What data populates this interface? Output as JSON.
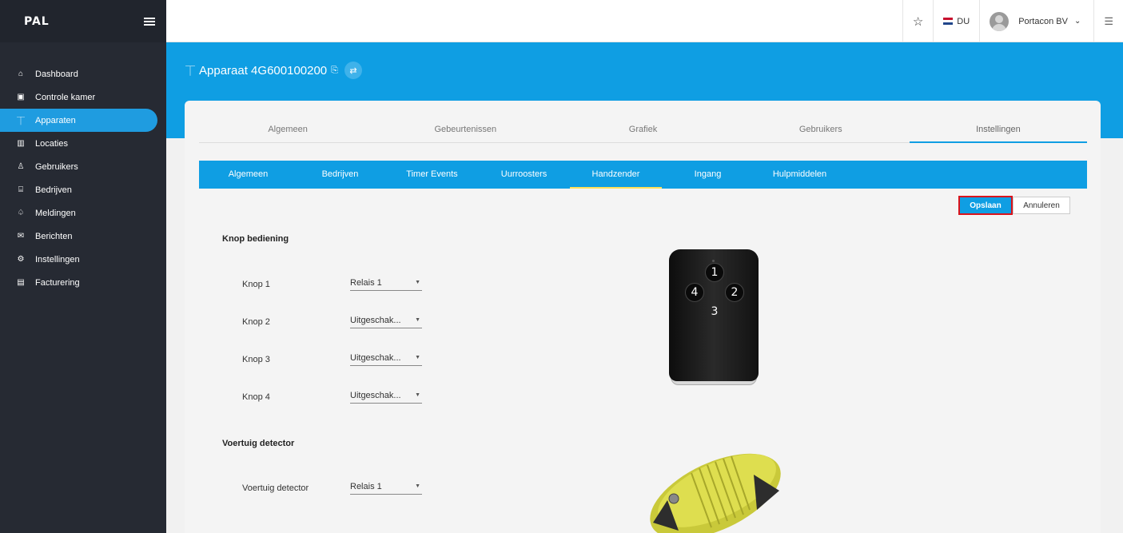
{
  "app": {
    "logo": "PAL"
  },
  "sidebar": {
    "items": [
      {
        "label": "Dashboard",
        "icon": "home-icon",
        "glyph": "⌂"
      },
      {
        "label": "Controle kamer",
        "icon": "control-room-icon",
        "glyph": "▣"
      },
      {
        "label": "Apparaten",
        "icon": "device-icon",
        "glyph": "⏉",
        "active": true
      },
      {
        "label": "Locaties",
        "icon": "map-icon",
        "glyph": "▥"
      },
      {
        "label": "Gebruikers",
        "icon": "user-icon",
        "glyph": "♙"
      },
      {
        "label": "Bedrijven",
        "icon": "company-icon",
        "glyph": "⌸"
      },
      {
        "label": "Meldingen",
        "icon": "bell-icon",
        "glyph": "♤"
      },
      {
        "label": "Berichten",
        "icon": "mail-icon",
        "glyph": "✉"
      },
      {
        "label": "Instellingen",
        "icon": "gear-icon",
        "glyph": "⚙"
      },
      {
        "label": "Facturering",
        "icon": "invoice-icon",
        "glyph": "▤"
      }
    ]
  },
  "topbar": {
    "star": "☆",
    "language": "DU",
    "user": "Portacon BV",
    "user_caret": "⌄",
    "menu": "☰"
  },
  "header": {
    "title": "Apparaat 4G600100200",
    "title_icon": "⏉",
    "copy_glyph": "⎘",
    "swap_glyph": "⇄"
  },
  "main_tabs": [
    "Algemeen",
    "Gebeurtenissen",
    "Grafiek",
    "Gebruikers",
    "Instellingen"
  ],
  "sub_tabs": [
    "Algemeen",
    "Bedrijven",
    "Timer Events",
    "Uurroosters",
    "Handzender",
    "Ingang",
    "Hulpmiddelen"
  ],
  "actions": {
    "save": "Opslaan",
    "cancel": "Annuleren"
  },
  "knop_section": {
    "title": "Knop bediening",
    "rows": [
      {
        "label": "Knop 1",
        "value": "Relais 1"
      },
      {
        "label": "Knop 2",
        "value": "Uitgeschak..."
      },
      {
        "label": "Knop 3",
        "value": "Uitgeschak..."
      },
      {
        "label": "Knop 4",
        "value": "Uitgeschak..."
      }
    ],
    "remote_buttons": [
      "1",
      "2",
      "3",
      "4"
    ]
  },
  "detector_section": {
    "title": "Voertuig detector",
    "label": "Voertuig detector",
    "value": "Relais 1"
  },
  "caret": "▼",
  "colors": {
    "accent": "#0f9ee3",
    "sidebar": "#262a33",
    "highlight": "#d9141c"
  }
}
